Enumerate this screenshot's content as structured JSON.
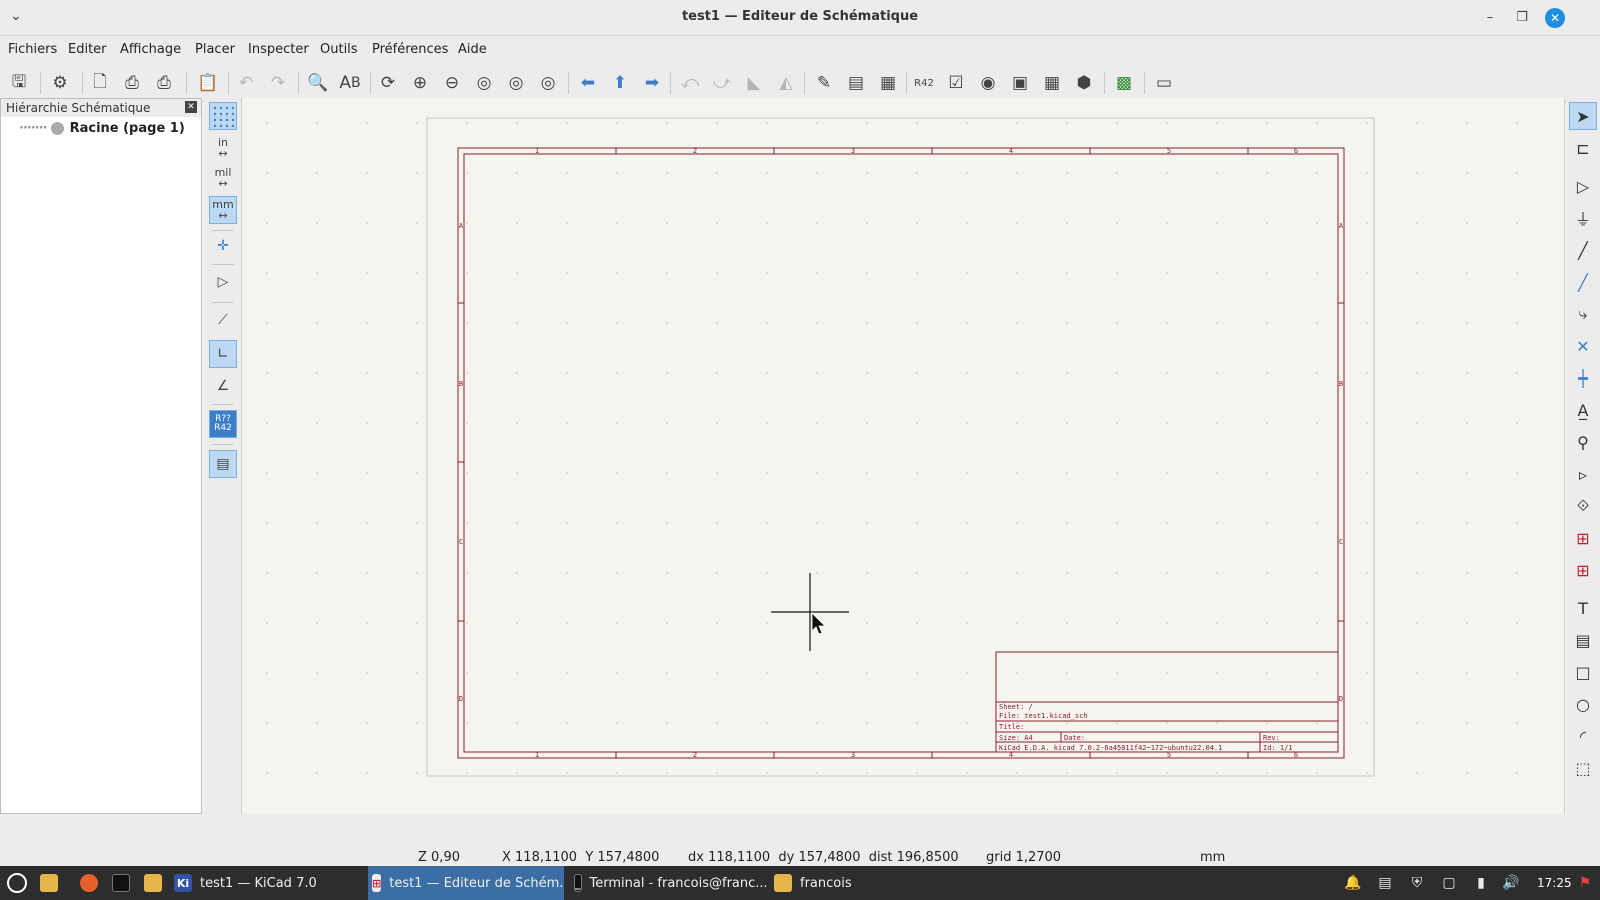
{
  "window": {
    "title": "test1 — Editeur de Schématique"
  },
  "menu": [
    "Fichiers",
    "Editer",
    "Affichage",
    "Placer",
    "Inspecter",
    "Outils",
    "Préférences",
    "Aide"
  ],
  "toolbar_icons": [
    "save-icon",
    "schematic-setup-icon",
    "page-settings-icon",
    "print-icon",
    "plot-icon",
    "paste-icon",
    "undo-icon",
    "redo-icon",
    "find-icon",
    "find-replace-icon",
    "refresh-icon",
    "zoom-in-icon",
    "zoom-out-icon",
    "zoom-fit-icon",
    "zoom-objects-icon",
    "zoom-selection-icon",
    "navigate-back-icon",
    "navigate-up-icon",
    "navigate-forward-icon",
    "rotate-ccw-icon",
    "rotate-cw-icon",
    "mirror-vertical-icon",
    "mirror-horizontal-icon",
    "symbol-editor-icon",
    "symbol-browser-icon",
    "footprint-assign-icon",
    "annotate-icon",
    "erc-icon",
    "simulator-icon",
    "footprint-editor-icon",
    "bom-table-icon",
    "bom-generate-icon",
    "pcb-editor-icon",
    "scripting-console-icon"
  ],
  "hierarchy": {
    "header": "Hiérarchie Schématique",
    "close": "✕",
    "root": "Racine (page 1)"
  },
  "left_tools": {
    "in": "in",
    "mil": "mil",
    "mm": "mm",
    "annotate": "R??\nR42"
  },
  "title_block": {
    "sheet": "Sheet: /",
    "file": "File: test1.kicad_sch",
    "title": "Title:",
    "size": "Size: A4",
    "date": "Date:",
    "rev": "Rev:",
    "kicad": "KiCad E.D.A.  kicad 7.0.2-6a45011f42~172~ubuntu22.04.1",
    "id": "Id: 1/1"
  },
  "border_labels": {
    "top": [
      "1",
      "2",
      "3",
      "4",
      "5",
      "6"
    ],
    "bottom": [
      "1",
      "2",
      "3",
      "4",
      "5",
      "6"
    ],
    "left": [
      "A",
      "B",
      "C",
      "D"
    ],
    "right": [
      "A",
      "B",
      "C",
      "D"
    ]
  },
  "status": {
    "zoom": "Z 0,90",
    "xy": "X 118,1100  Y 157,4800",
    "delta": "dx 118,1100  dy 157,4800  dist 196,8500",
    "grid": "grid 1,2700",
    "units": "mm"
  },
  "taskbar": {
    "tasks": [
      "test1 — KiCad 7.0",
      "test1 — Editeur de Schém...",
      "Terminal - francois@franc...",
      "francois"
    ],
    "clock": "17:25"
  }
}
